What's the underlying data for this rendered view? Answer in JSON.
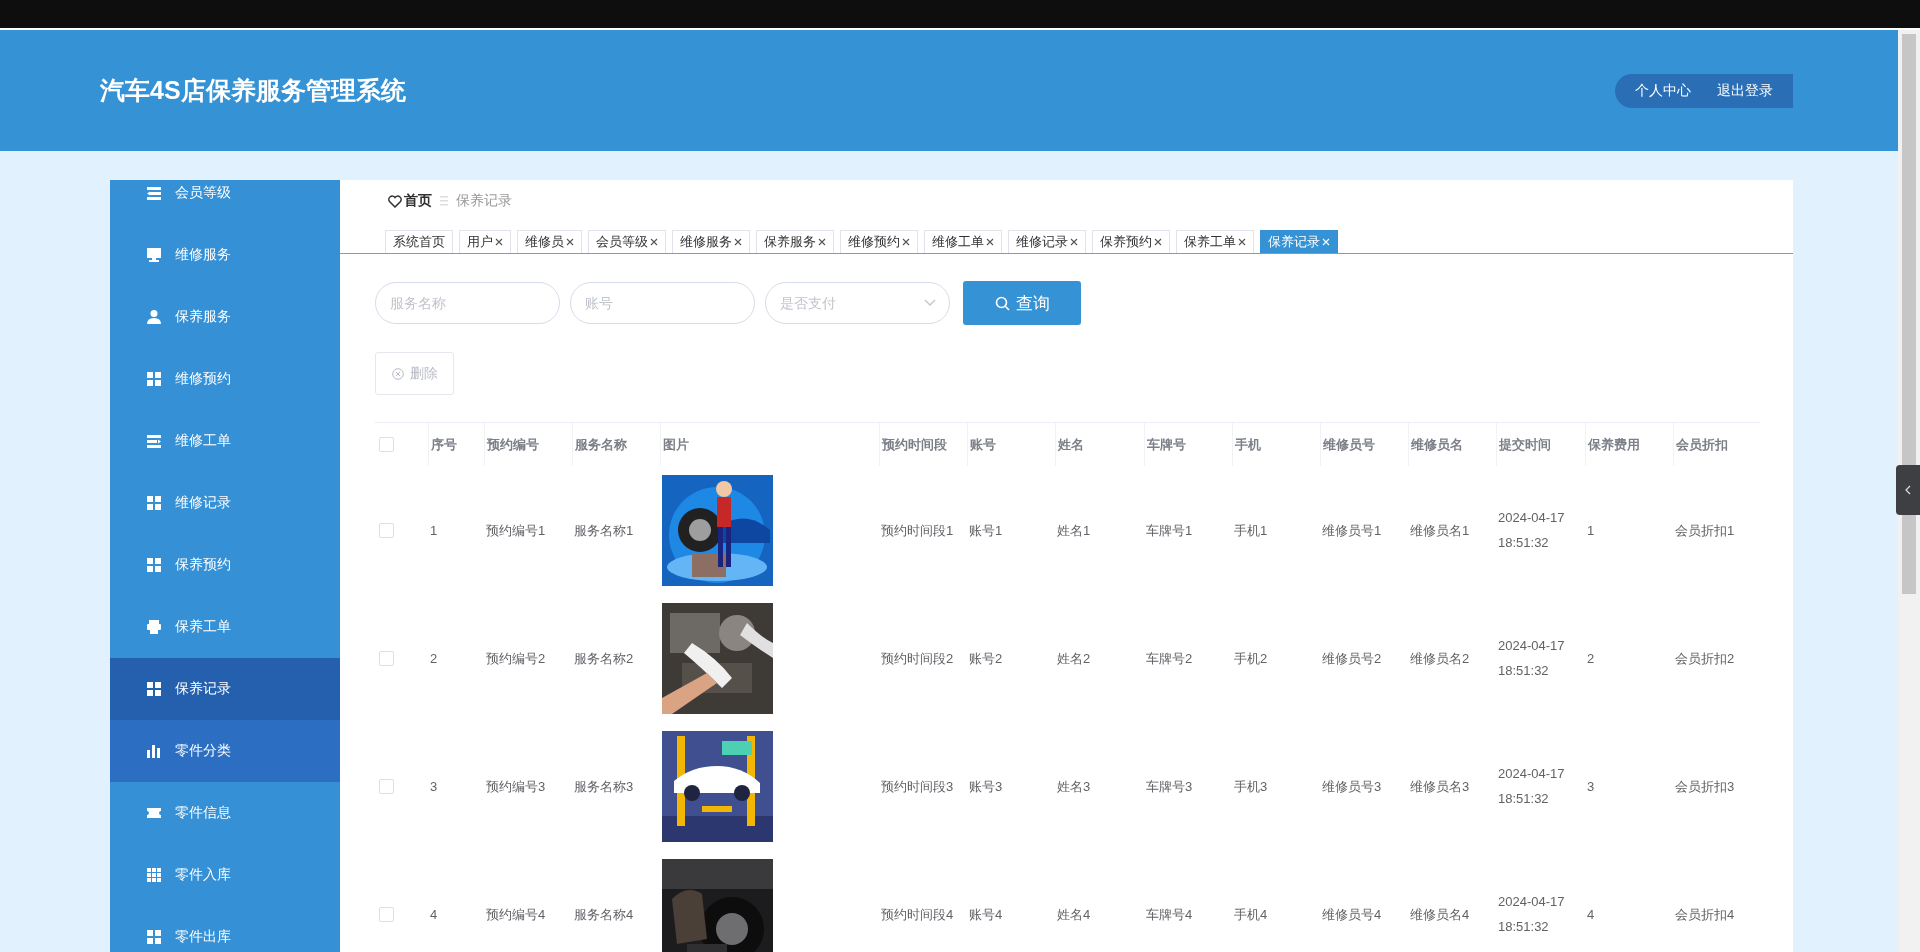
{
  "header": {
    "title": "汽车4S店保养服务管理系统",
    "actions": [
      "个人中心",
      "退出登录"
    ]
  },
  "sidebar": {
    "items": [
      {
        "label": "会员等级",
        "selected": false,
        "hovered": false
      },
      {
        "label": "维修服务",
        "selected": false,
        "hovered": false
      },
      {
        "label": "保养服务",
        "selected": false,
        "hovered": false
      },
      {
        "label": "维修预约",
        "selected": false,
        "hovered": false
      },
      {
        "label": "维修工单",
        "selected": false,
        "hovered": false
      },
      {
        "label": "维修记录",
        "selected": false,
        "hovered": false
      },
      {
        "label": "保养预约",
        "selected": false,
        "hovered": false
      },
      {
        "label": "保养工单",
        "selected": false,
        "hovered": false
      },
      {
        "label": "保养记录",
        "selected": true,
        "hovered": false
      },
      {
        "label": "零件分类",
        "selected": false,
        "hovered": true
      },
      {
        "label": "零件信息",
        "selected": false,
        "hovered": false
      },
      {
        "label": "零件入库",
        "selected": false,
        "hovered": false
      },
      {
        "label": "零件出库",
        "selected": false,
        "hovered": false
      }
    ]
  },
  "breadcrumb": {
    "home": "首页",
    "current": "保养记录"
  },
  "tabs": [
    {
      "label": "系统首页",
      "closable": false,
      "selected": false
    },
    {
      "label": "用户",
      "closable": true,
      "selected": false
    },
    {
      "label": "维修员",
      "closable": true,
      "selected": false
    },
    {
      "label": "会员等级",
      "closable": true,
      "selected": false
    },
    {
      "label": "维修服务",
      "closable": true,
      "selected": false
    },
    {
      "label": "保养服务",
      "closable": true,
      "selected": false
    },
    {
      "label": "维修预约",
      "closable": true,
      "selected": false
    },
    {
      "label": "维修工单",
      "closable": true,
      "selected": false
    },
    {
      "label": "维修记录",
      "closable": true,
      "selected": false
    },
    {
      "label": "保养预约",
      "closable": true,
      "selected": false
    },
    {
      "label": "保养工单",
      "closable": true,
      "selected": false
    },
    {
      "label": "保养记录",
      "closable": true,
      "selected": true
    }
  ],
  "filters": {
    "fields": [
      {
        "kind": "text",
        "placeholder": "服务名称"
      },
      {
        "kind": "text",
        "placeholder": "账号"
      },
      {
        "kind": "select",
        "placeholder": "是否支付"
      }
    ],
    "search_button": "查询"
  },
  "toolbar": {
    "delete_button": {
      "label": "删除",
      "disabled": true
    }
  },
  "table": {
    "header_checked": false,
    "columns": [
      {
        "kind": "text",
        "label": "序号"
      },
      {
        "kind": "text",
        "label": "预约编号"
      },
      {
        "kind": "text",
        "label": "服务名称"
      },
      {
        "kind": "picture",
        "label": "图片"
      },
      {
        "kind": "text",
        "label": "预约时间段"
      },
      {
        "kind": "text",
        "label": "账号"
      },
      {
        "kind": "text",
        "label": "姓名"
      },
      {
        "kind": "text",
        "label": "车牌号"
      },
      {
        "kind": "text",
        "label": "手机"
      },
      {
        "kind": "text",
        "label": "维修员号"
      },
      {
        "kind": "text",
        "label": "维修员名"
      },
      {
        "kind": "text",
        "label": "提交时间"
      },
      {
        "kind": "text",
        "label": "保养费用"
      },
      {
        "kind": "text",
        "label": "会员折扣"
      }
    ],
    "rows": [
      {
        "checked": false,
        "values": [
          "1",
          "预约编号1",
          "服务名称1",
          "预约时间段1",
          "账号1",
          "姓名1",
          "车牌号1",
          "手机1",
          "维修员号1",
          "维修员名1",
          "2024-04-17 18:51:32",
          "1",
          "会员折扣1"
        ]
      },
      {
        "checked": false,
        "values": [
          "2",
          "预约编号2",
          "服务名称2",
          "预约时间段2",
          "账号2",
          "姓名2",
          "车牌号2",
          "手机2",
          "维修员号2",
          "维修员名2",
          "2024-04-17 18:51:32",
          "2",
          "会员折扣2"
        ]
      },
      {
        "checked": false,
        "values": [
          "3",
          "预约编号3",
          "服务名称3",
          "预约时间段3",
          "账号3",
          "姓名3",
          "车牌号3",
          "手机3",
          "维修员号3",
          "维修员名3",
          "2024-04-17 18:51:32",
          "3",
          "会员折扣3"
        ]
      },
      {
        "checked": false,
        "values": [
          "4",
          "预约编号4",
          "服务名称4",
          "预约时间段4",
          "账号4",
          "姓名4",
          "车牌号4",
          "手机4",
          "维修员号4",
          "维修员名4",
          "2024-04-17 18:51:32",
          "4",
          "会员折扣4"
        ]
      }
    ]
  }
}
